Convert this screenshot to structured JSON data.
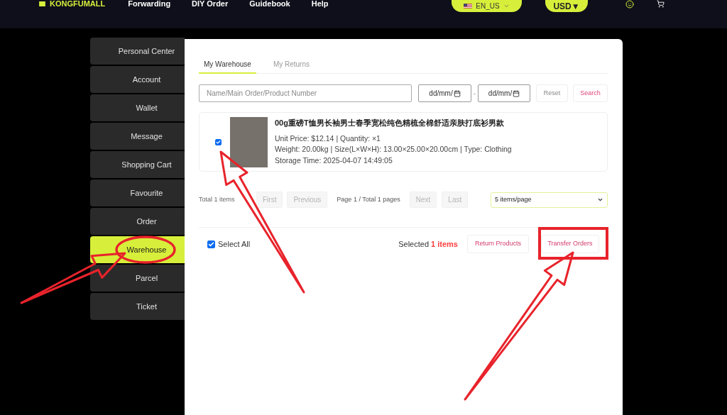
{
  "header": {
    "logo": "KONGFUMALL",
    "nav": [
      "Forwarding",
      "DIY Order",
      "Guidebook",
      "Help"
    ],
    "language": "EN_US",
    "currency": "USD▼"
  },
  "sidebar": {
    "items": [
      {
        "label": "Personal Center",
        "selected": false
      },
      {
        "label": "Account",
        "selected": false
      },
      {
        "label": "Wallet",
        "selected": false
      },
      {
        "label": "Message",
        "selected": false
      },
      {
        "label": "Shopping Cart",
        "selected": false
      },
      {
        "label": "Favourite",
        "selected": false
      },
      {
        "label": "Order",
        "selected": false
      },
      {
        "label": "Warehouse",
        "selected": true
      },
      {
        "label": "Parcel",
        "selected": false
      },
      {
        "label": "Ticket",
        "selected": false
      }
    ]
  },
  "tabs": [
    {
      "label": "My Warehouse",
      "selected": true
    },
    {
      "label": "My Returns",
      "selected": false
    }
  ],
  "filters": {
    "search": {
      "placeholder": "Name/Main Order/Product Number"
    },
    "date_from": {
      "placeholder": "dd/mm/"
    },
    "separator": "-",
    "date_to": {
      "placeholder": "dd/mm/"
    },
    "reset": "Reset",
    "search_button": "Search"
  },
  "products": [
    {
      "checked": true,
      "title": "00g重磅T恤男长袖男士春季宽松纯色精梳全棉舒适亲肤打底衫男款",
      "details": [
        "Unit Price: $12.14 | Quantity: ×1",
        "Weight: 20.00kg | Size(L×W×H): 13.00×25.00×20.00cm | Type: Clothing",
        "Storage Time: 2025-04-07 14:49:05"
      ]
    }
  ],
  "pagination": {
    "total": "Total 1 items",
    "items": [
      {
        "kind": "button",
        "label": "First",
        "disabled": true
      },
      {
        "kind": "button",
        "label": "Previous",
        "disabled": true
      },
      {
        "kind": "info",
        "label": "Page 1 / Total 1 pages"
      },
      {
        "kind": "button",
        "label": "Next",
        "disabled": true
      },
      {
        "kind": "button",
        "label": "Last",
        "disabled": true
      }
    ],
    "page_size": "5 items/page"
  },
  "footer": {
    "select_all": {
      "label": "Select All",
      "checked": true
    },
    "summary": "Selected **1 items**",
    "buttons": [
      "Return Products",
      "Transfer Orders"
    ]
  }
}
